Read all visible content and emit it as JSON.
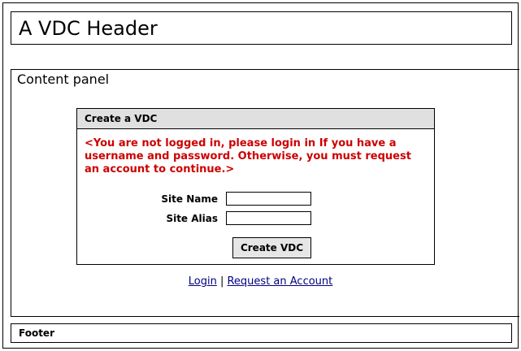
{
  "header": {
    "title": "A VDC Header"
  },
  "content": {
    "title": "Content panel",
    "panel": {
      "title": "Create a VDC",
      "error_message": "<You are not logged in, please login in If you have a username and password. Otherwise, you must request an account to continue.>",
      "fields": [
        {
          "label": "Site Name",
          "value": "",
          "placeholder": ""
        },
        {
          "label": "Site Alias",
          "value": "",
          "placeholder": ""
        }
      ],
      "submit_label": "Create VDC"
    },
    "links": {
      "login": "Login",
      "separator": "|",
      "request_account": "Request an Account"
    }
  },
  "footer": {
    "text": "Footer"
  },
  "colors": {
    "error": "#cc0000",
    "link": "#000080",
    "panel_header_bg": "#e0e0e0",
    "button_bg": "#e6e6e6"
  }
}
